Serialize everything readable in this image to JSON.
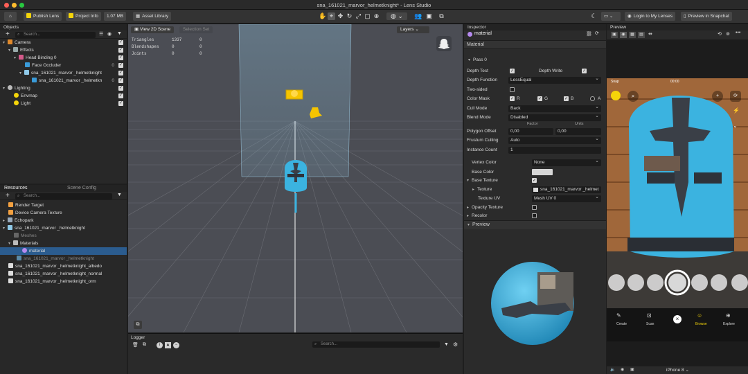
{
  "window": {
    "title": "sna_161021_marvor_helmetknight* - Lens Studio"
  },
  "toolbar": {
    "publish_lens": "Publish Lens",
    "project_info": "Project Info",
    "size": "1.07 MB",
    "asset_library": "Asset Library",
    "login": "Login to My Lenses",
    "preview_snapchat": "Preview in Snapchat"
  },
  "objects_panel": {
    "header": "Objects",
    "search_placeholder": "Search...",
    "items": [
      {
        "label": "Camera"
      },
      {
        "label": "Effects"
      },
      {
        "label": "Head Binding 0"
      },
      {
        "label": "Face Occluder",
        "count": "0"
      },
      {
        "label": "sna_161021_marvor _helmetknight"
      },
      {
        "label": "sna_161021_marvor _helmetkn",
        "count": "0"
      },
      {
        "label": "Lighting"
      },
      {
        "label": "Envmap"
      },
      {
        "label": "Light"
      }
    ]
  },
  "resources_panel": {
    "tab_resources": "Resources",
    "tab_scene_config": "Scene Config",
    "search_placeholder": "Search...",
    "items": [
      {
        "label": "Render Target"
      },
      {
        "label": "Device Camera Texture"
      },
      {
        "label": "Echopark"
      },
      {
        "label": "sna_161021_marvor _helmetknight"
      },
      {
        "label": "Meshes"
      },
      {
        "label": "Materials"
      },
      {
        "label": "material"
      },
      {
        "label": "sna_161021_marvor _helmetknight"
      },
      {
        "label": "sna_161021_marvor _helmetknight_albedo"
      },
      {
        "label": "sna_161021_marvor _helmetknight_normal"
      },
      {
        "label": "sna_161021_marvor _helmetknight_orm"
      }
    ]
  },
  "viewport": {
    "tab_2d": "View 2D Scene",
    "tab_selection": "Selection Set",
    "layers": "Layers",
    "stats": [
      {
        "label": "Triangles",
        "v1": "1337",
        "v2": "0"
      },
      {
        "label": "Blendshapes",
        "v1": "0",
        "v2": "0"
      },
      {
        "label": "Joints",
        "v1": "0",
        "v2": "0"
      }
    ]
  },
  "logger": {
    "header": "Logger",
    "search_placeholder": "Search..."
  },
  "inspector": {
    "header": "Inspector",
    "object_name": "material",
    "section": "Material",
    "pass": "Pass 0",
    "depth_test": "Depth Test",
    "depth_write": "Depth Write",
    "depth_function": "Depth Function",
    "depth_function_value": "LessEqual",
    "two_sided": "Two-sided",
    "color_mask": "Color Mask",
    "mask_r": "R",
    "mask_g": "G",
    "mask_b": "B",
    "mask_a": "A",
    "cull_mode": "Cull Mode",
    "cull_mode_value": "Back",
    "blend_mode": "Blend Mode",
    "blend_mode_value": "Disabled",
    "factor": "Factor",
    "units": "Units",
    "polygon_offset": "Polygon Offset",
    "polygon_factor": "0,00",
    "polygon_units": "0,00",
    "frustum_culling": "Frustum Culling",
    "frustum_culling_value": "Auto",
    "instance_count": "Instance Count",
    "instance_count_value": "1",
    "vertex_color": "Vertex Color",
    "vertex_color_value": "None",
    "base_color": "Base Color",
    "base_texture": "Base Texture",
    "texture": "Texture",
    "texture_value": "sna_161021_marvor _helmet",
    "texture_uv": "Texture UV",
    "texture_uv_value": "Mesh UV 0",
    "opacity_texture": "Opacity Texture",
    "recolor": "Recolor",
    "preview": "Preview"
  },
  "preview_panel": {
    "header": "Preview",
    "status_carrier": "Snap",
    "status_time": "00:00",
    "nav": [
      "Create",
      "Scan",
      "Browse",
      "Explore"
    ],
    "device": "iPhone 8"
  },
  "colors": {
    "helmet_blue": "#3bb3e0",
    "accent_yellow": "#f5d50a",
    "selection_blue": "#2b5c8f"
  }
}
